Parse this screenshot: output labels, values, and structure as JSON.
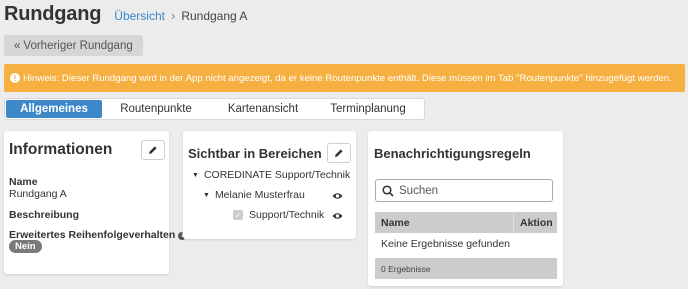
{
  "page": {
    "title": "Rundgang"
  },
  "breadcrumb": {
    "parent": "Übersicht",
    "separator": "›",
    "current": "Rundgang A"
  },
  "prev_button": {
    "chevron": "«",
    "label": "Vorheriger Rundgang"
  },
  "alert": {
    "icon": "!",
    "text": "Hinweis: Dieser Rundgang wird in der App nicht angezeigt, da er keine Routenpunkte enthält. Diese müssen im Tab \"Routenpunkte\" hinzugefügt werden.",
    "color": "#f6b041"
  },
  "tabs": [
    {
      "label": "Allgemeines",
      "active": true
    },
    {
      "label": "Routenpunkte",
      "active": false
    },
    {
      "label": "Kartenansicht",
      "active": false
    },
    {
      "label": "Terminplanung",
      "active": false
    }
  ],
  "info": {
    "title": "Informationen",
    "name_label": "Name",
    "name_value": "Rundgang A",
    "description_label": "Beschreibung",
    "order_label": "Erweitertes Reihenfolgeverhalten",
    "order_icon": "i",
    "order_value": "Nein"
  },
  "areas": {
    "title": "Sichtbar in Bereichen",
    "tree": [
      {
        "label": "COREDINATE Support/Technik",
        "level": 0,
        "expanded": true
      },
      {
        "label": "Melanie Musterfrau",
        "level": 1,
        "expanded": true,
        "icon": "eye-icon"
      },
      {
        "label": "Support/Technik",
        "level": 2,
        "checked": true,
        "icon": "eye-icon"
      }
    ]
  },
  "notifications": {
    "title": "Benachrichtigungsregeln",
    "search_placeholder": "Suchen",
    "columns": [
      "Name",
      "Aktion"
    ],
    "empty_text": "Keine Ergebnisse gefunden",
    "footer": "0 Ergebnisse"
  },
  "colors": {
    "accent": "#3e88c9",
    "link": "#3a87c8",
    "background": "#ececec"
  }
}
